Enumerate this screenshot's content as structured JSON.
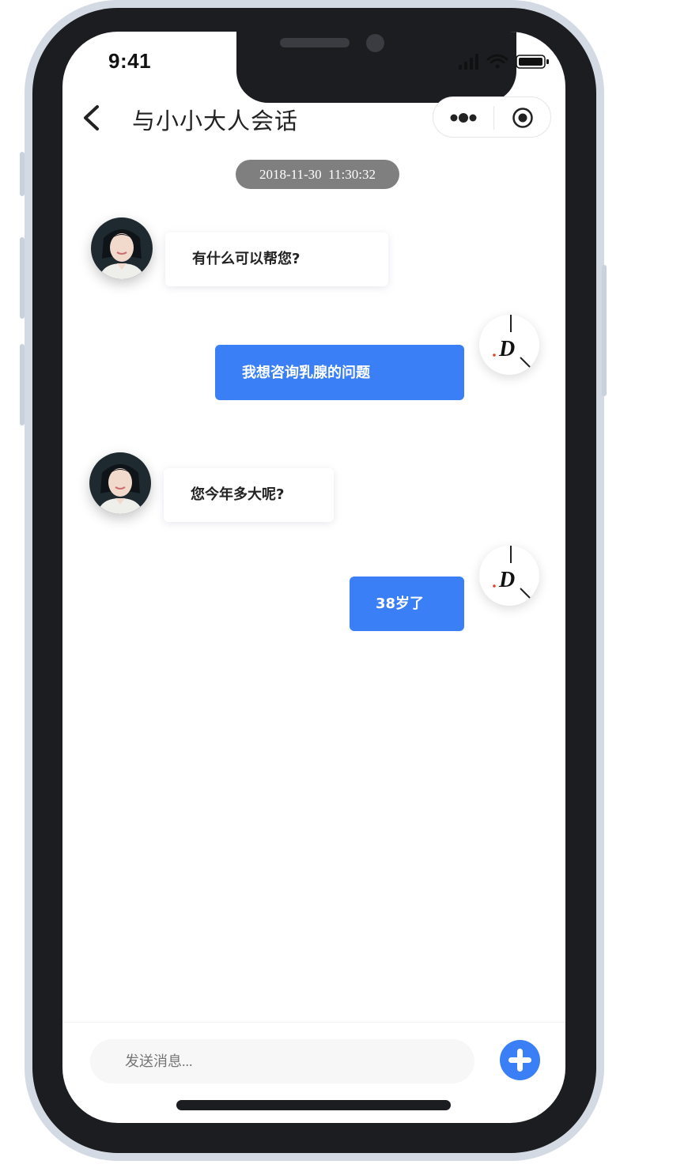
{
  "status_bar": {
    "time": "9:41"
  },
  "nav": {
    "title": "与小小大人会话"
  },
  "chat": {
    "timestamp": "2018-11-30  11:30:32",
    "messages": [
      {
        "from": "doctor",
        "text": "有什么可以帮您?"
      },
      {
        "from": "user",
        "text": "我想咨询乳腺的问题"
      },
      {
        "from": "doctor",
        "text": "您今年多大呢?"
      },
      {
        "from": "user",
        "text": "38岁了"
      }
    ],
    "user_avatar_text": "D"
  },
  "composer": {
    "placeholder": "发送消息..."
  },
  "colors": {
    "accent": "#3a7ff5",
    "timestamp_bg": "#7f7f7f",
    "frame": "#1c1d21"
  }
}
